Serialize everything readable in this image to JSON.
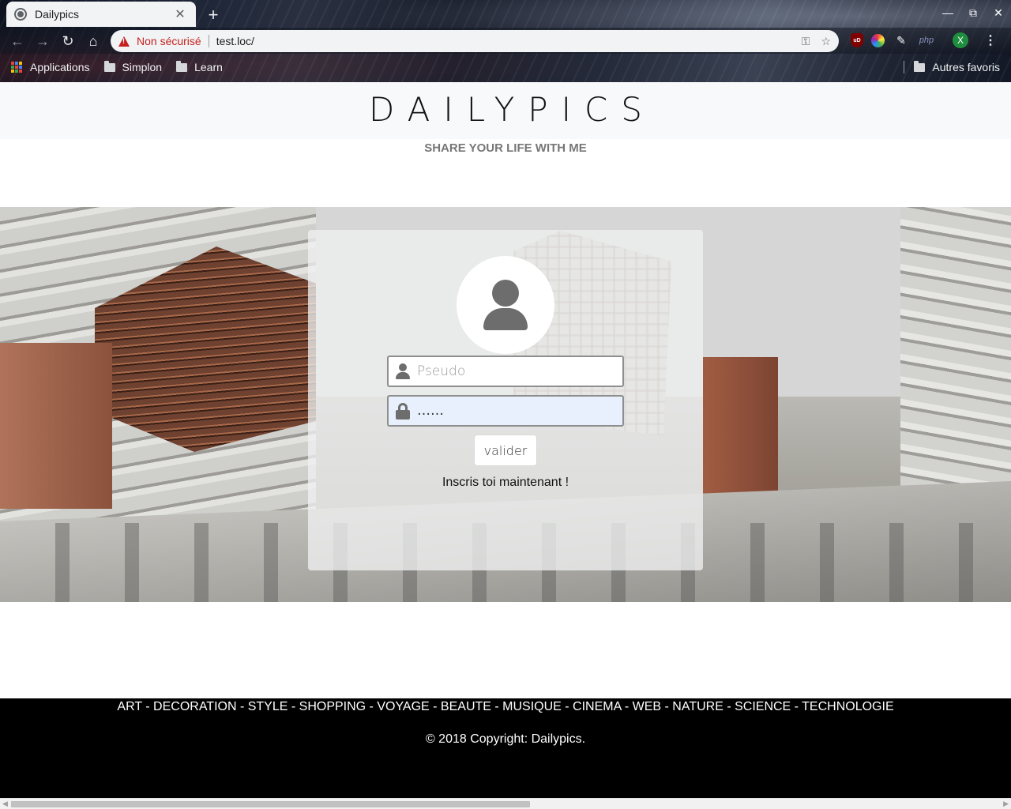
{
  "browser": {
    "tab_title": "Dailypics",
    "tab_close": "✕",
    "new_tab": "+",
    "security_label": "Non sécurisé",
    "url": "test.loc/",
    "avatar_letter": "X",
    "ext_php": "php",
    "ext_ublock": "uD",
    "bookmarks": [
      {
        "label": "Applications",
        "icon": "apps-grid-icon"
      },
      {
        "label": "Simplon",
        "icon": "folder-icon"
      },
      {
        "label": "Learn",
        "icon": "folder-icon"
      }
    ],
    "other_bookmarks": "Autres favoris"
  },
  "site": {
    "logo": "DAILYPICS",
    "tagline": "SHARE YOUR LIFE WITH ME"
  },
  "login": {
    "pseudo_placeholder": "Pseudo",
    "pseudo_value": "",
    "password_value": "……",
    "submit_label": "valider",
    "signup_text": "Inscris toi maintenant !"
  },
  "footer": {
    "categories": "ART - DECORATION - STYLE - SHOPPING - VOYAGE - BEAUTE - MUSIQUE - CINEMA - WEB - NATURE - SCIENCE - TECHNOLOGIE",
    "copyright": "© 2018 Copyright: Dailypics."
  },
  "colors": {
    "header_bg": "#f8f9fa",
    "footer_bg": "#000000",
    "password_autofill_bg": "#e8f0fe",
    "not_secure_red": "#c5221f"
  }
}
